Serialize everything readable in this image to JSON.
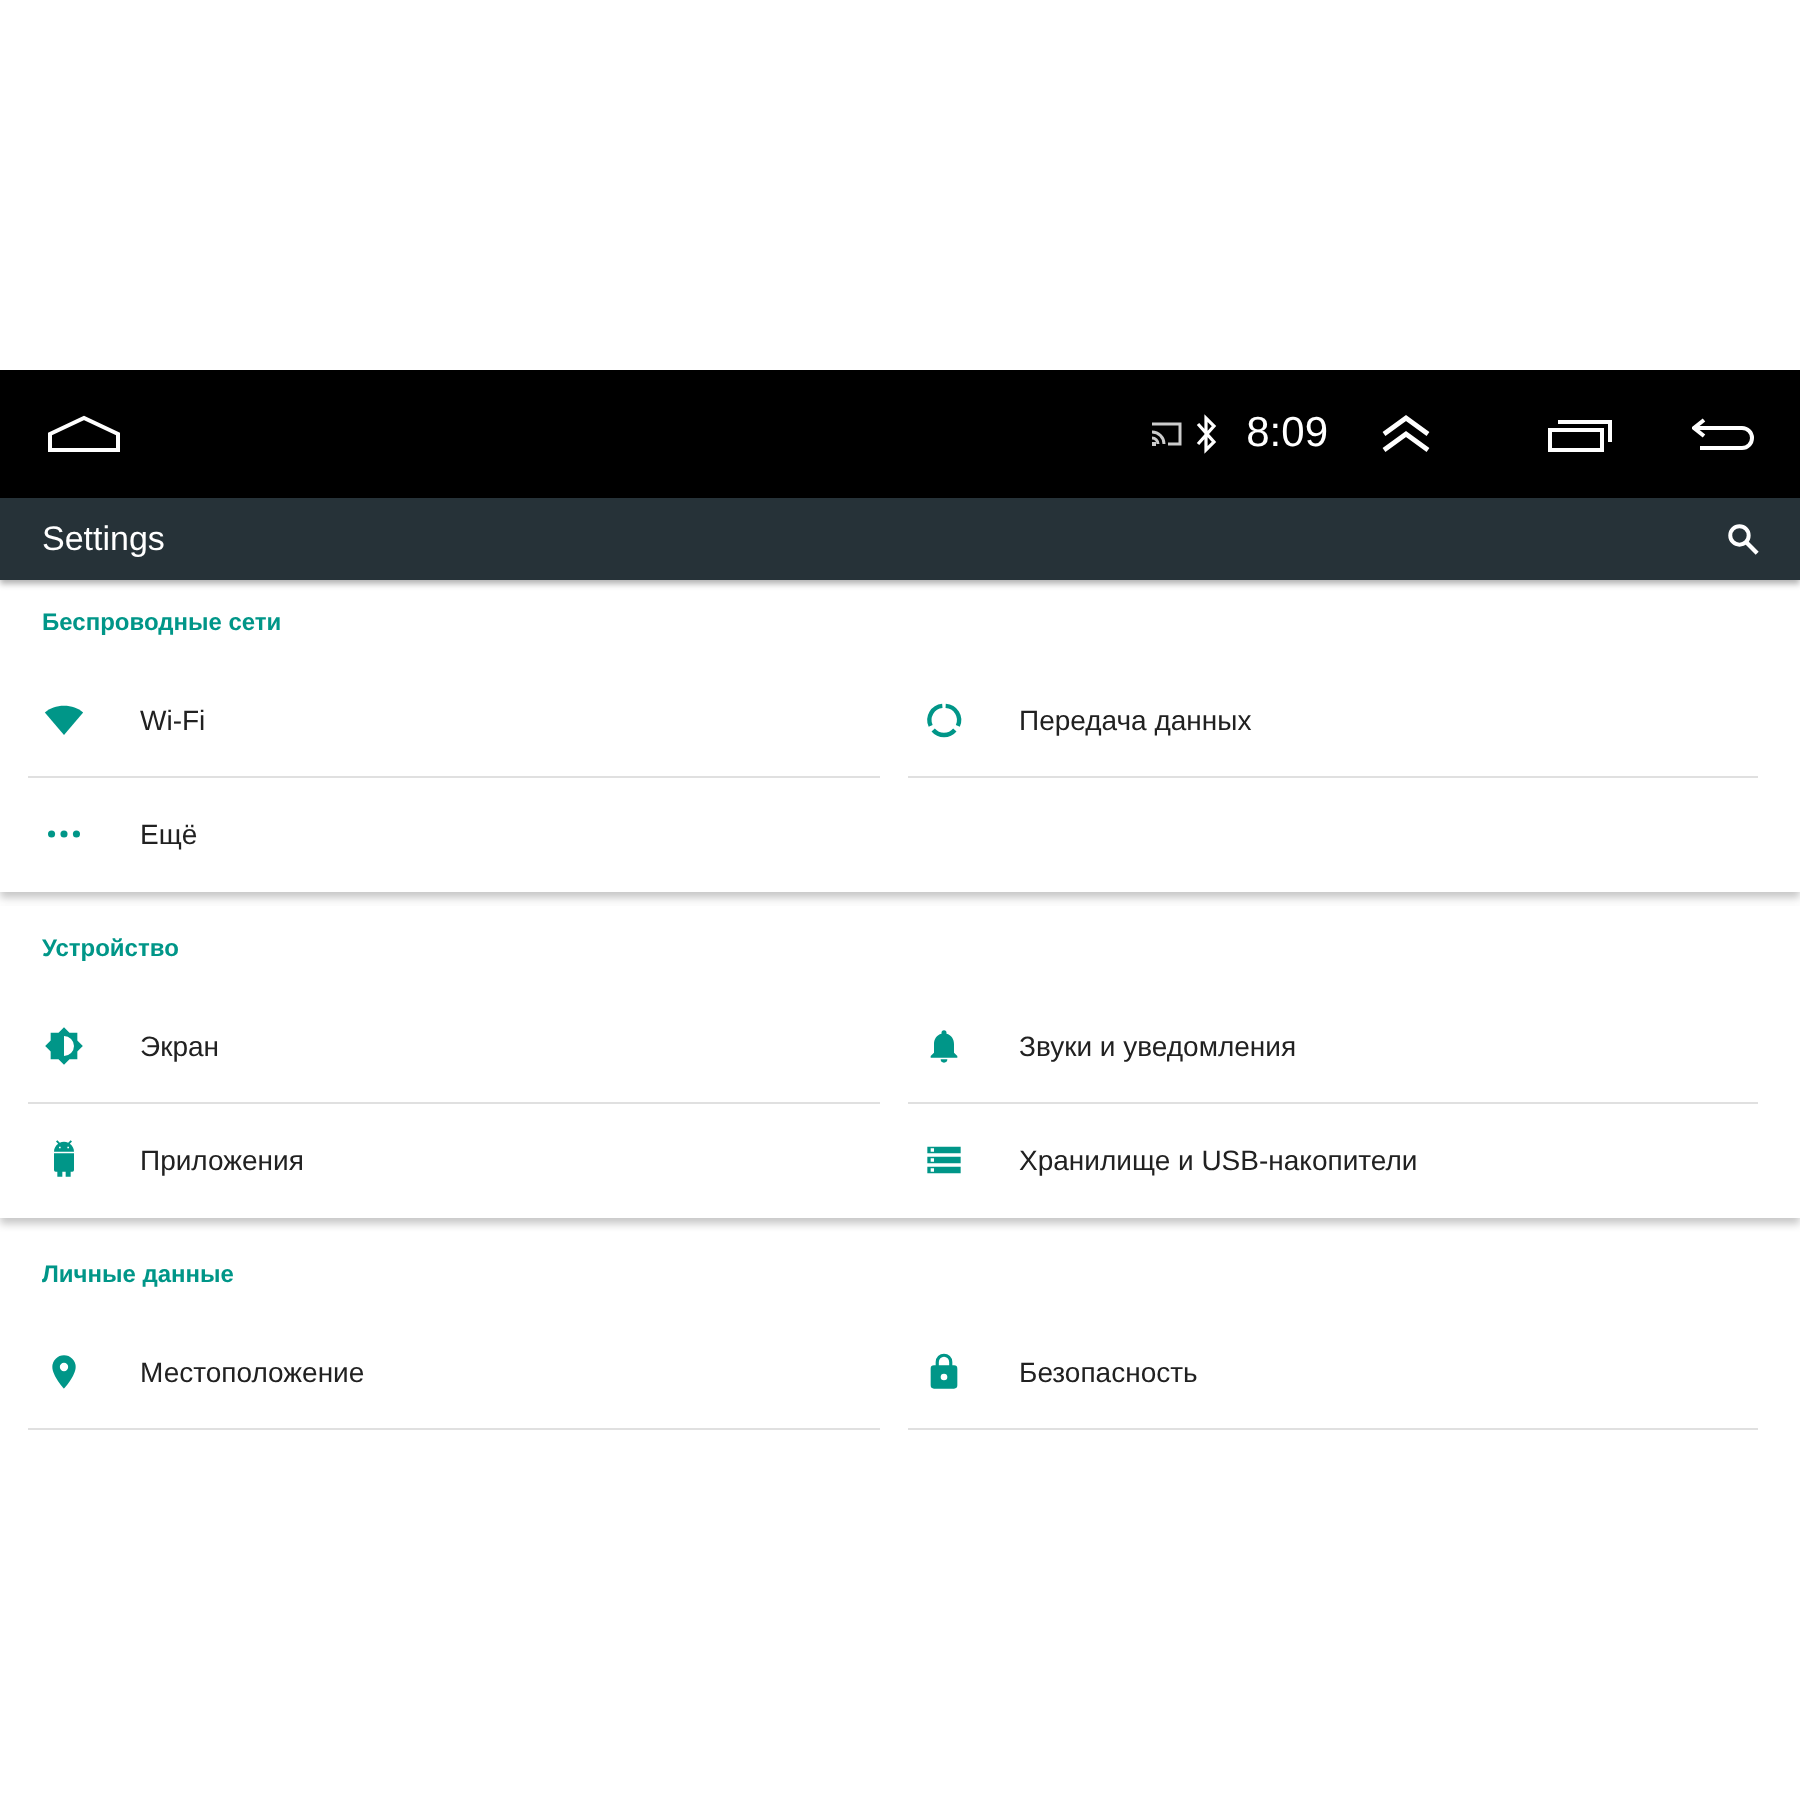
{
  "status_bar": {
    "time": "8:09"
  },
  "toolbar": {
    "title": "Settings"
  },
  "sections": [
    {
      "title": "Беспроводные сети",
      "items": [
        {
          "label": "Wi-Fi",
          "kind": "wifi"
        },
        {
          "label": "Передача данных",
          "kind": "data"
        },
        {
          "label": "Ещё",
          "kind": "more"
        }
      ]
    },
    {
      "title": "Устройство",
      "items": [
        {
          "label": "Экран",
          "kind": "display"
        },
        {
          "label": "Звуки и уведомления",
          "kind": "sound"
        },
        {
          "label": "Приложения",
          "kind": "apps"
        },
        {
          "label": "Хранилище и USB-накопители",
          "kind": "storage"
        }
      ]
    },
    {
      "title": "Личные данные",
      "items": [
        {
          "label": "Местоположение",
          "kind": "location"
        },
        {
          "label": "Безопасность",
          "kind": "security"
        }
      ]
    }
  ]
}
